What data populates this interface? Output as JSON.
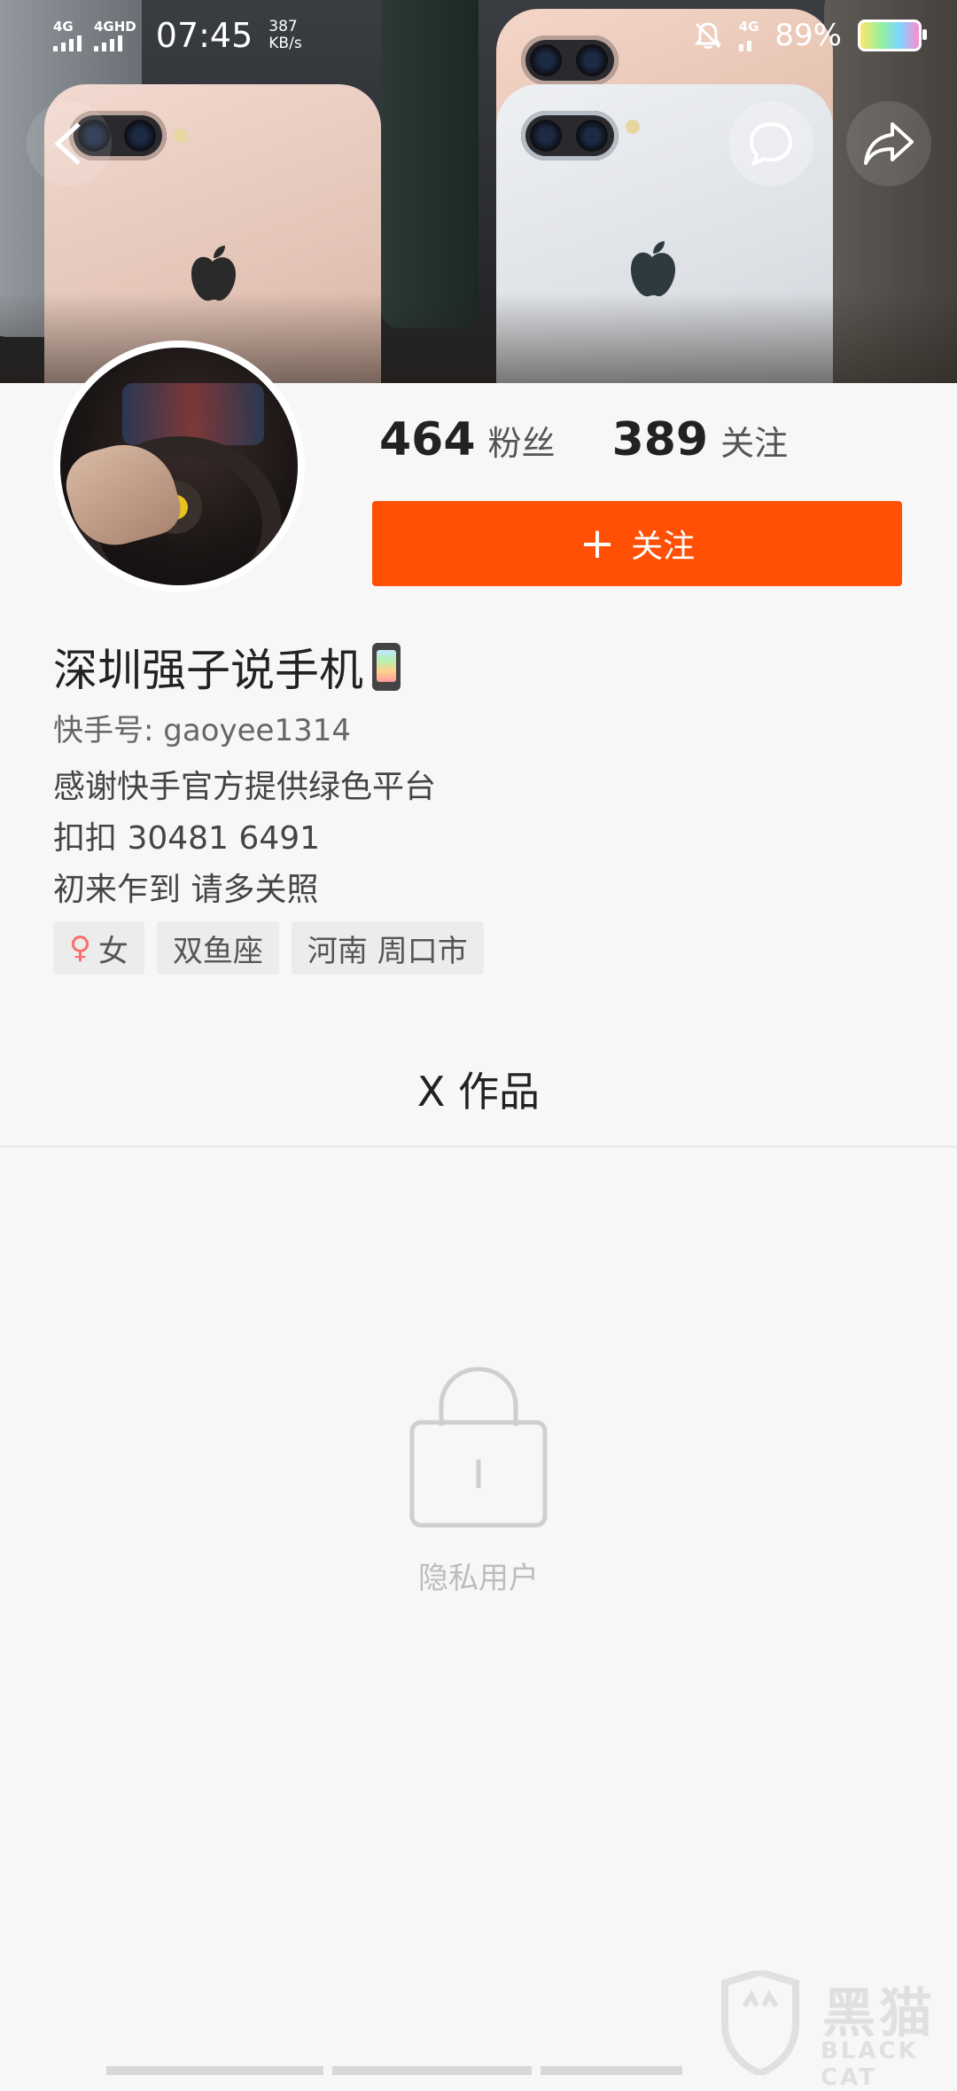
{
  "status_bar": {
    "network_1": "4G",
    "network_2": "4GHD",
    "time": "07:45",
    "speed_value": "387",
    "speed_unit": "KB/s",
    "network_right": "4G",
    "battery_percent": "89%"
  },
  "header": {
    "back_icon": "chevron-left-icon",
    "message_icon": "chat-bubble-icon",
    "share_icon": "share-arrow-icon"
  },
  "profile": {
    "fans_count": "464",
    "fans_label": "粉丝",
    "following_count": "389",
    "following_label": "关注",
    "follow_button_label": "关注",
    "name": "深圳强子说手机",
    "kuaishou_id": "快手号: gaoyee1314",
    "bio_lines": [
      "感谢快手官方提供绿色平台",
      "扣扣 30481 6491",
      "初来乍到 请多关照"
    ],
    "tags": [
      {
        "icon": "female-icon",
        "label": "女"
      },
      {
        "label": "双鱼座"
      },
      {
        "label": "河南 周口市"
      }
    ]
  },
  "works": {
    "title": "X 作品"
  },
  "empty_state": {
    "icon": "lock-icon",
    "message": "隐私用户"
  },
  "watermark": {
    "text": "黑猫",
    "sub": "BLACK CAT"
  },
  "colors": {
    "accent": "#ff5005",
    "background": "#f7f7f7"
  }
}
